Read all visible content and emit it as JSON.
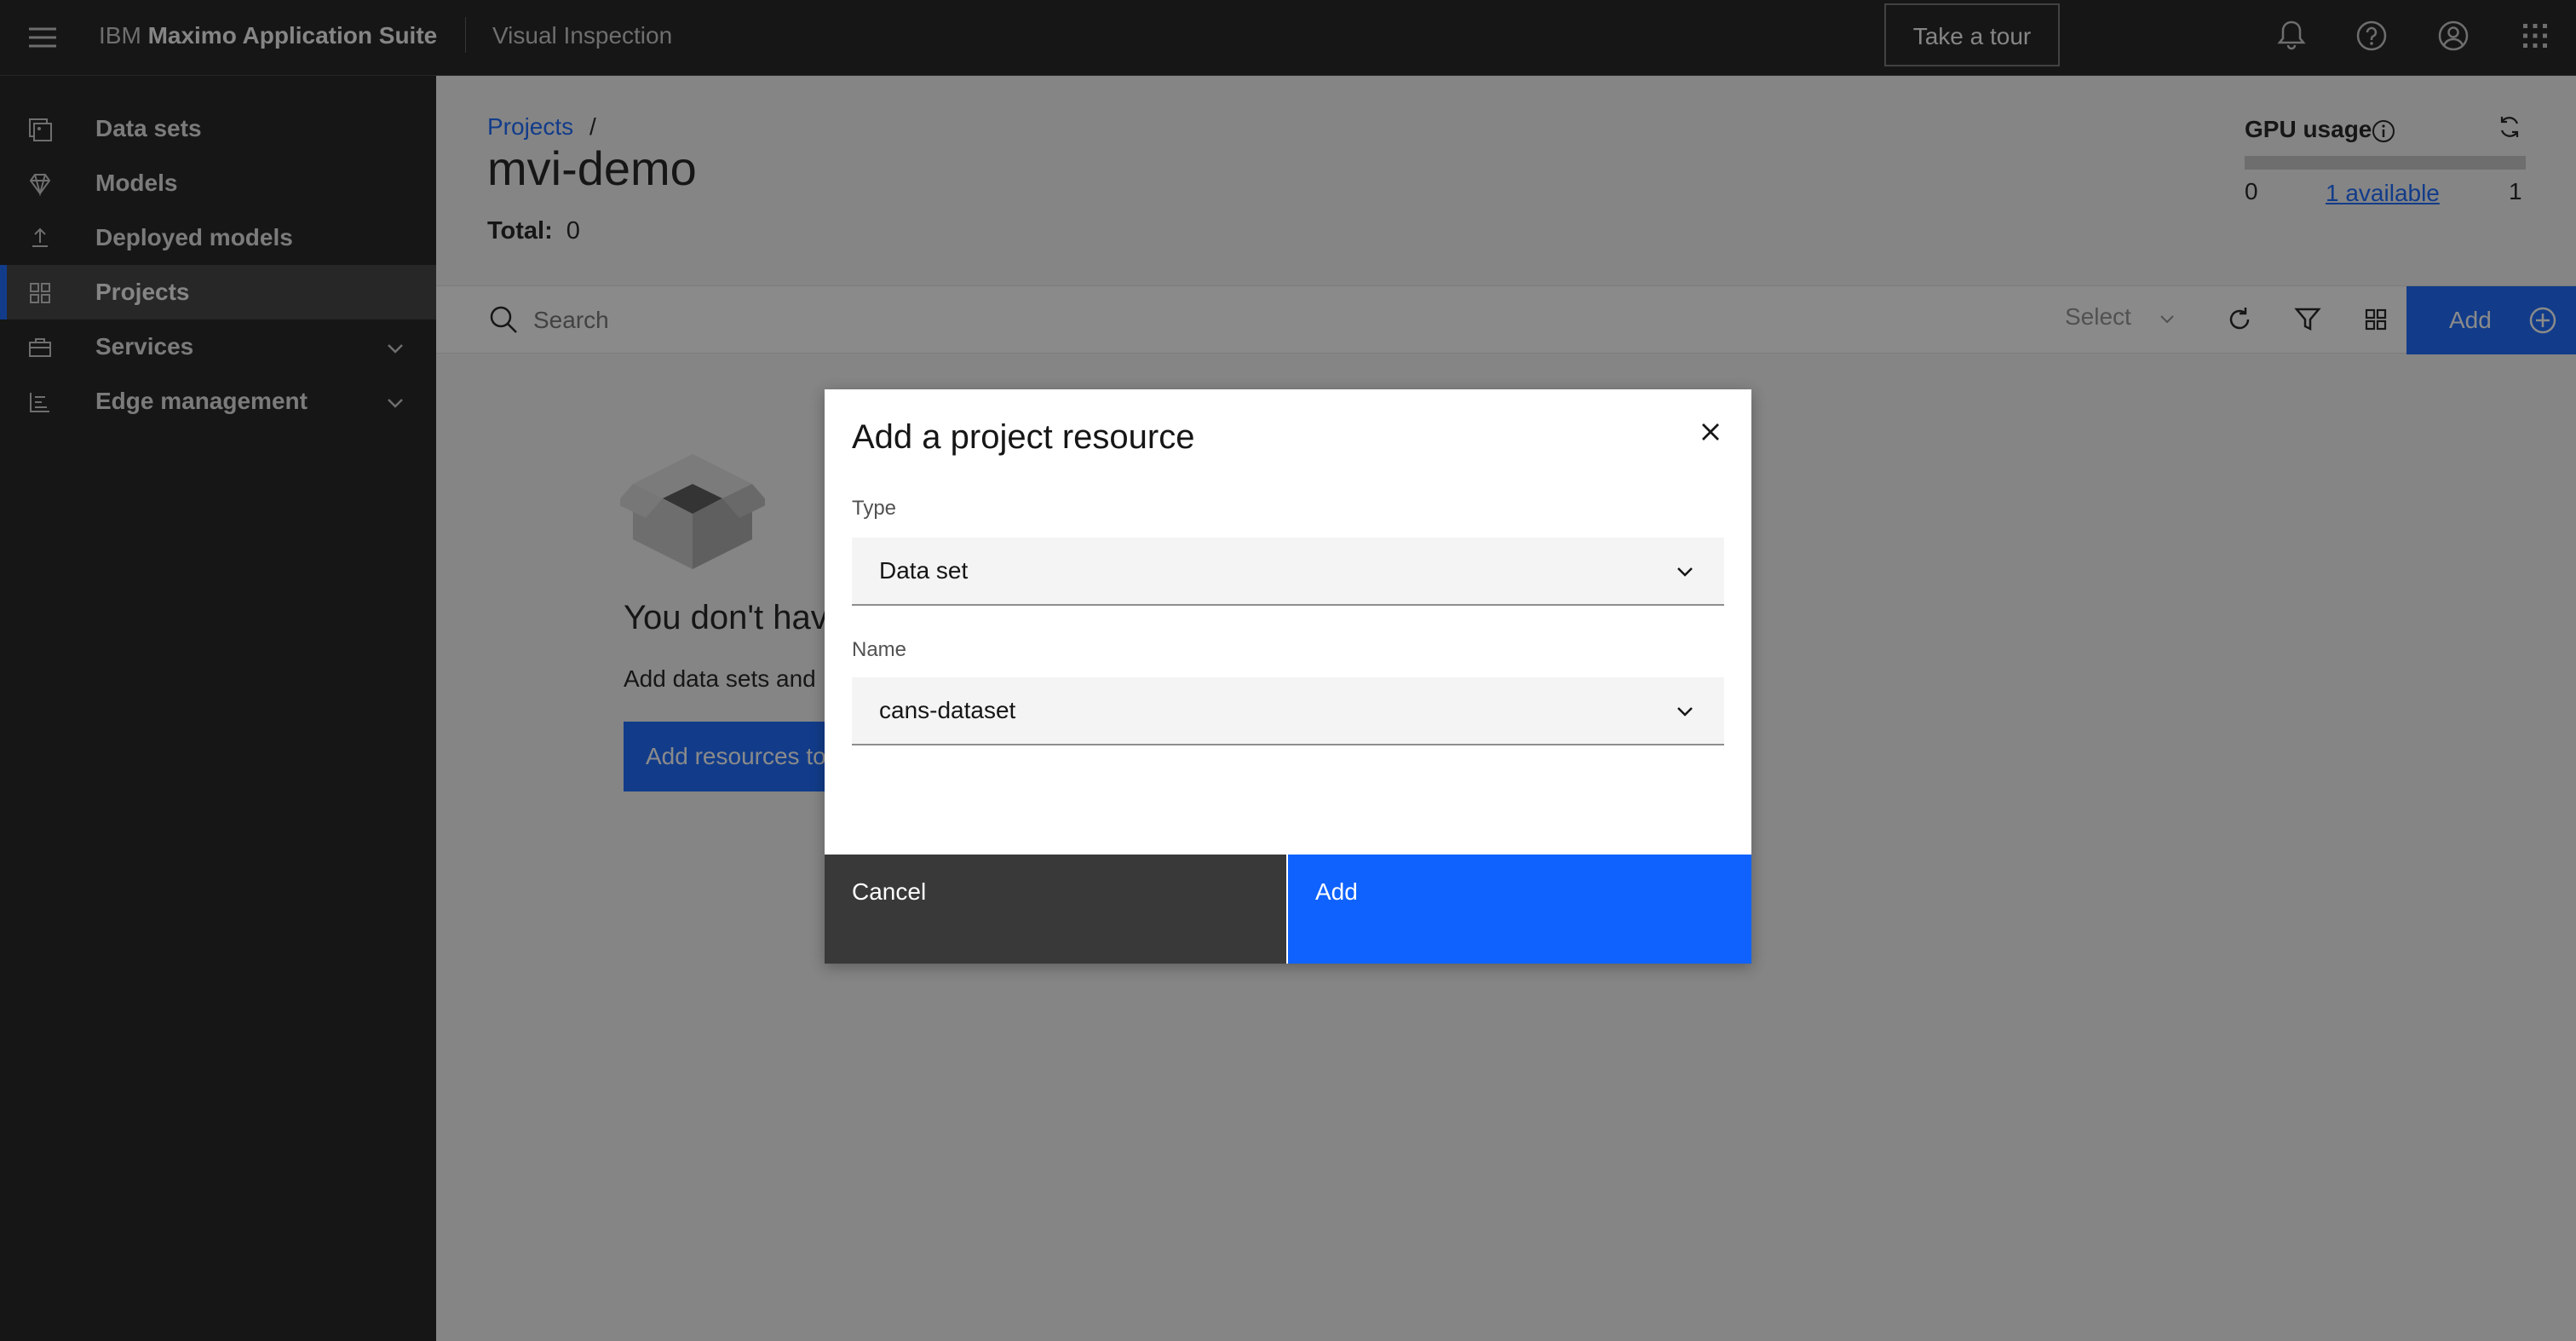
{
  "header": {
    "brand_prefix": "IBM",
    "brand_name": "Maximo Application Suite",
    "product": "Visual Inspection",
    "tour_button": "Take a tour",
    "icons": [
      "menu-icon",
      "notification-icon",
      "help-icon",
      "user-icon",
      "app-switcher-icon"
    ]
  },
  "sidebar": {
    "items": [
      {
        "label": "Data sets",
        "icon": "datasets-icon",
        "active": false
      },
      {
        "label": "Models",
        "icon": "models-icon",
        "active": false
      },
      {
        "label": "Deployed models",
        "icon": "deploy-icon",
        "active": false
      },
      {
        "label": "Projects",
        "icon": "projects-icon",
        "active": true
      },
      {
        "label": "Services",
        "icon": "services-icon",
        "expandable": true
      },
      {
        "label": "Edge management",
        "icon": "edge-icon",
        "expandable": true
      }
    ]
  },
  "main": {
    "breadcrumb": "Projects",
    "breadcrumb_sep": "/",
    "title": "mvi-demo",
    "total_label": "Total:",
    "total_value": "0",
    "gpu": {
      "title": "GPU usage",
      "min": "0",
      "available": "1 available",
      "max": "1",
      "used_fraction": 0
    },
    "toolbar": {
      "search_placeholder": "Search",
      "select_label": "Select",
      "add_label": "Add"
    },
    "empty": {
      "title": "You don't hav",
      "description": "Add data sets and",
      "button": "Add resources to"
    }
  },
  "modal": {
    "title": "Add a project resource",
    "type_label": "Type",
    "type_value": "Data set",
    "name_label": "Name",
    "name_value": "cans-dataset",
    "cancel": "Cancel",
    "add": "Add"
  },
  "colors": {
    "primary": "#0f62fe",
    "header_bg": "#161616",
    "cancel_bg": "#393939"
  }
}
